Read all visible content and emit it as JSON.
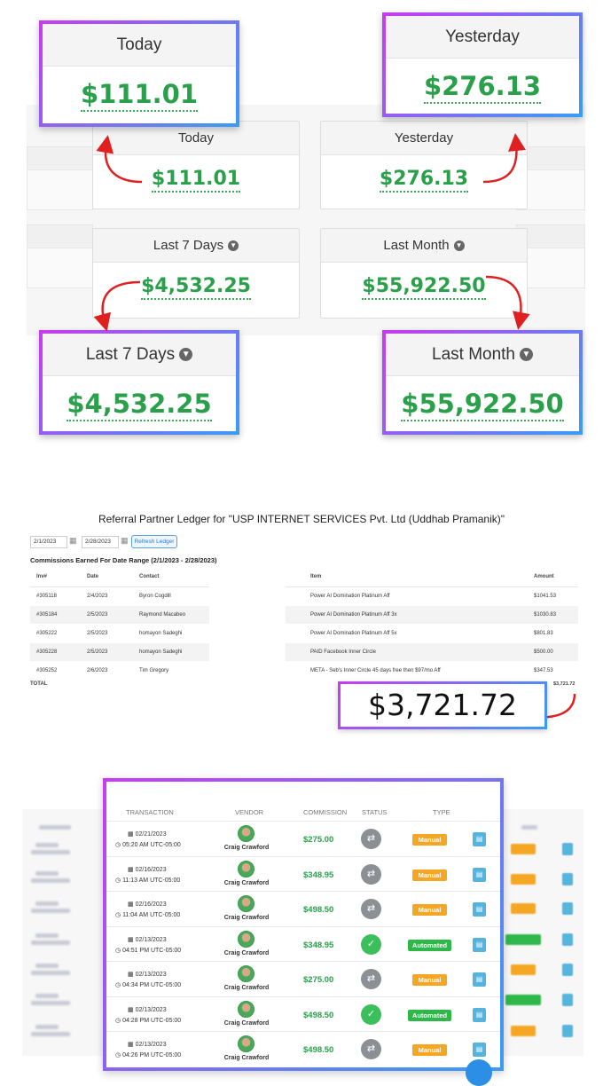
{
  "stats": {
    "today": {
      "label": "Today",
      "value": "$111.01"
    },
    "yesterday": {
      "label": "Yesterday",
      "value": "$276.13"
    },
    "last7": {
      "label": "Last 7 Days",
      "value": "$4,532.25"
    },
    "lastMonth": {
      "label": "Last Month",
      "value": "$55,922.50"
    }
  },
  "ledger": {
    "title": "Referral Partner Ledger for \"USP INTERNET SERVICES Pvt. Ltd (Uddhab Pramanik)\"",
    "date_from": "2/1/2023",
    "date_to": "2/28/2023",
    "refresh_label": "Refresh Ledger",
    "commissions_title": "Commissions Earned For Date Range (2/1/2023 - 2/28/2023)",
    "headers": {
      "inv": "Inv#",
      "date": "Date",
      "contact": "Contact",
      "item": "Item",
      "amount": "Amount"
    },
    "rows": [
      {
        "inv": "#305118",
        "date": "2/4/2023",
        "contact": "Byron Cogdill",
        "item": "Power AI Domination Platinum Aff",
        "amount": "$1041.53"
      },
      {
        "inv": "#305184",
        "date": "2/5/2023",
        "contact": "Raymond Macabeo",
        "item": "Power AI Domination Platinum Aff 3x",
        "amount": "$1030.83"
      },
      {
        "inv": "#305222",
        "date": "2/5/2023",
        "contact": "homayon Sadeghi",
        "item": "Power AI Domination Platinum Aff 5x",
        "amount": "$801.83"
      },
      {
        "inv": "#305228",
        "date": "2/5/2023",
        "contact": "homayon Sadeghi",
        "item": "PAID Facebook Inner Circle",
        "amount": "$500.00"
      },
      {
        "inv": "#305252",
        "date": "2/6/2023",
        "contact": "Tim Gregory",
        "item": "META - Seb's Inner Circle 45 days free then $97/mo Aff",
        "amount": "$347.53"
      }
    ],
    "total_label": "TOTAL",
    "total_small": "$3,721.72",
    "total_big": "$3,721.72"
  },
  "transactions": {
    "headers": {
      "transaction": "TRANSACTION",
      "vendor": "VENDOR",
      "commission": "COMMISSION",
      "status": "STATUS",
      "type": "TYPE"
    },
    "rows": [
      {
        "date": "02/21/2023",
        "time": "05:20 AM UTC-05:00",
        "vendor": "Craig Crawford",
        "commission": "$275.00",
        "status": "pending",
        "type": "Manual"
      },
      {
        "date": "02/16/2023",
        "time": "11:13 AM UTC-05:00",
        "vendor": "Craig Crawford",
        "commission": "$348.95",
        "status": "pending",
        "type": "Manual"
      },
      {
        "date": "02/16/2023",
        "time": "11:04 AM UTC-05:00",
        "vendor": "Craig Crawford",
        "commission": "$498.50",
        "status": "pending",
        "type": "Manual"
      },
      {
        "date": "02/13/2023",
        "time": "04:51 PM UTC-05:00",
        "vendor": "Craig Crawford",
        "commission": "$348.95",
        "status": "verified",
        "type": "Automated"
      },
      {
        "date": "02/13/2023",
        "time": "04:34 PM UTC-05:00",
        "vendor": "Craig Crawford",
        "commission": "$275.00",
        "status": "pending",
        "type": "Manual"
      },
      {
        "date": "02/13/2023",
        "time": "04:28 PM UTC-05:00",
        "vendor": "Craig Crawford",
        "commission": "$498.50",
        "status": "verified",
        "type": "Automated"
      },
      {
        "date": "02/13/2023",
        "time": "04:26 PM UTC-05:00",
        "vendor": "Craig Crawford",
        "commission": "$498.50",
        "status": "pending",
        "type": "Manual"
      }
    ]
  },
  "colors": {
    "accent_green": "#2aa04a",
    "highlight_purple": "#c83cf0",
    "highlight_blue": "#3a9cf5",
    "arrow_red": "#e02020"
  }
}
